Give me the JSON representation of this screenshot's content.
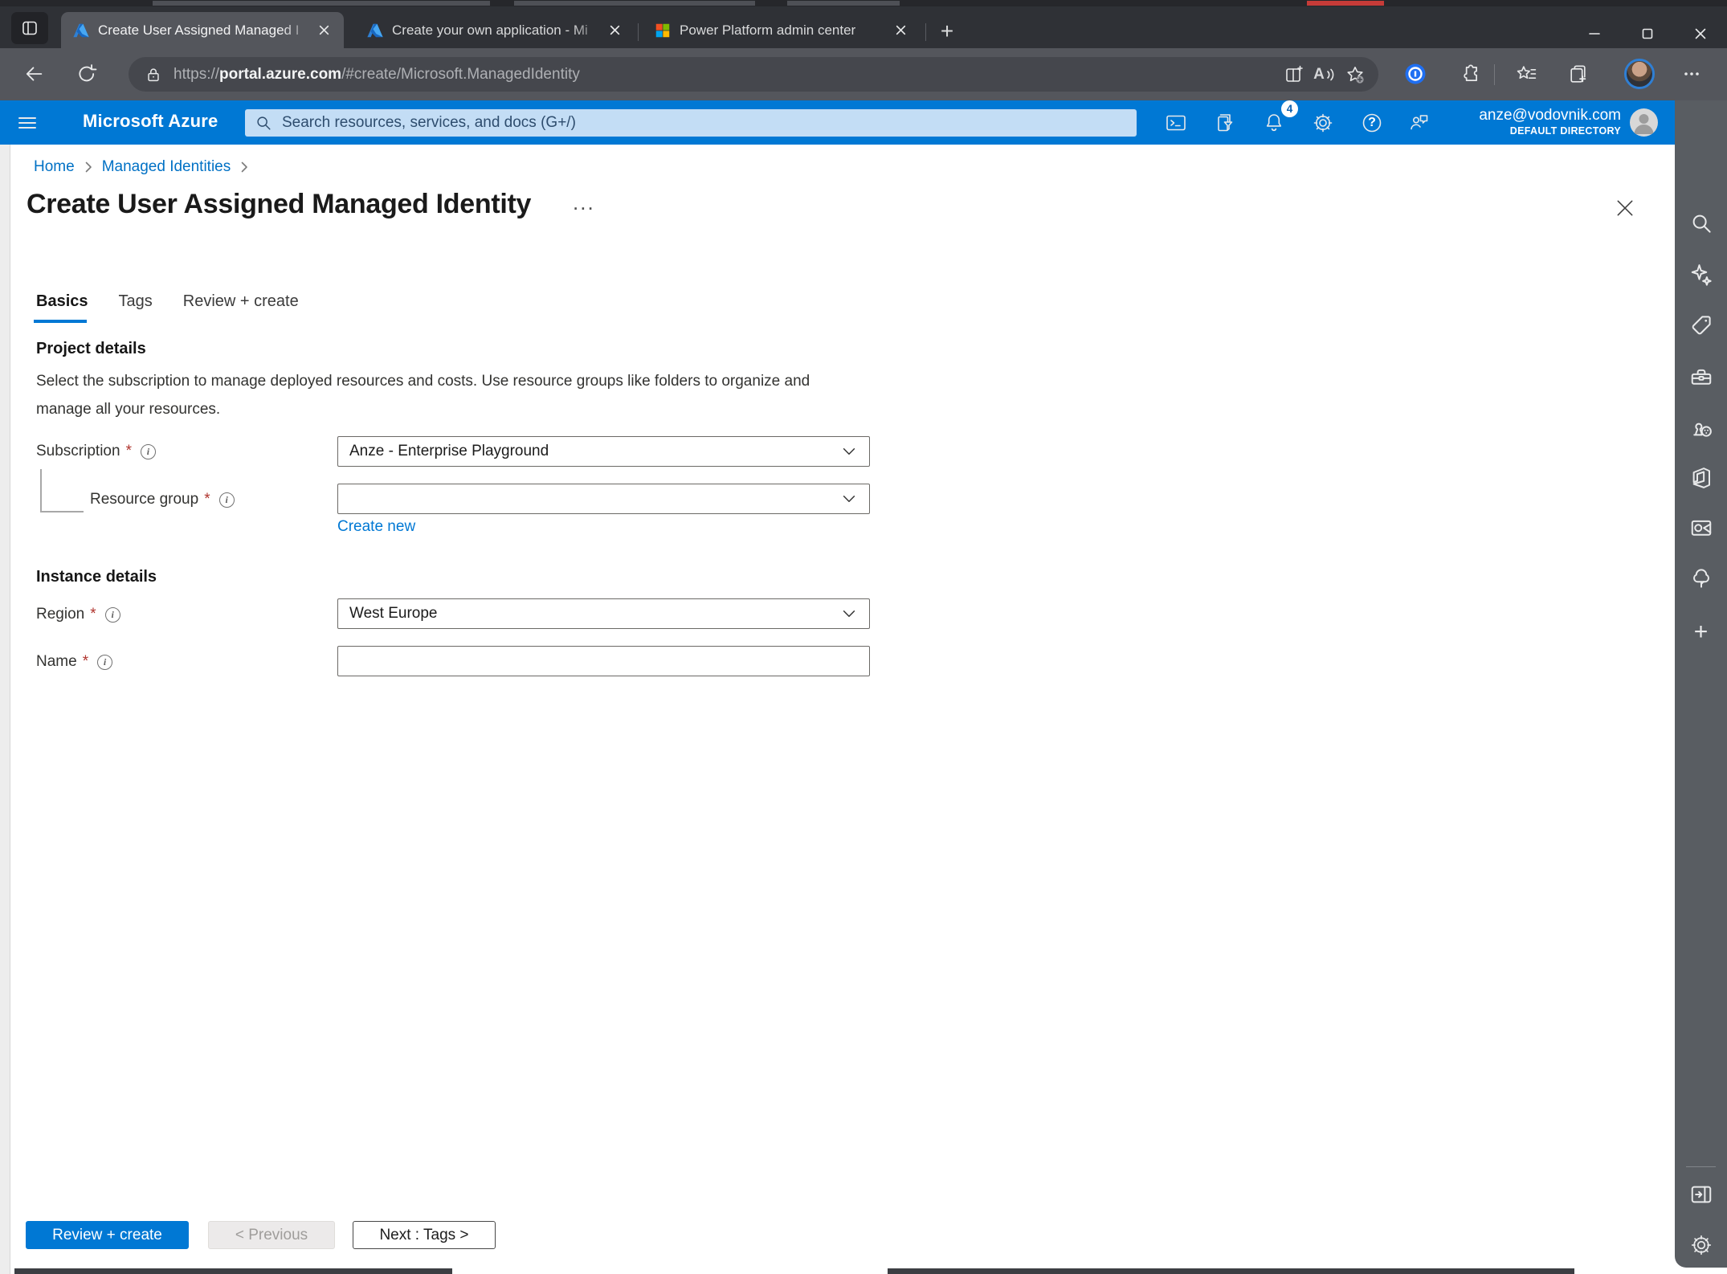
{
  "browser": {
    "tabs": [
      {
        "title": "Create User Assigned Managed I"
      },
      {
        "title": "Create your own application - Mi"
      },
      {
        "title": "Power Platform admin center"
      }
    ],
    "url": {
      "prefix": "https://",
      "domain": "portal.azure.com",
      "rest": "/#create/Microsoft.ManagedIdentity"
    }
  },
  "azure_bar": {
    "brand": "Microsoft Azure",
    "search_placeholder": "Search resources, services, and docs (G+/)",
    "notification_count": "4",
    "account": {
      "email": "anze@vodovnik.com",
      "directory": "DEFAULT DIRECTORY"
    }
  },
  "page": {
    "breadcrumb": {
      "home": "Home",
      "managed_identities": "Managed Identities"
    },
    "title": "Create User Assigned Managed Identity",
    "tabs": {
      "basics": "Basics",
      "tags": "Tags",
      "review": "Review + create"
    },
    "form": {
      "required_marker": "*",
      "project_details": {
        "heading": "Project details",
        "description": "Select the subscription to manage deployed resources and costs. Use resource groups like folders to organize and manage all your resources."
      },
      "subscription": {
        "label": "Subscription",
        "value": "Anze - Enterprise Playground"
      },
      "resource_group": {
        "label": "Resource group",
        "value": "",
        "create_new": "Create new"
      },
      "instance_details": {
        "heading": "Instance details"
      },
      "region": {
        "label": "Region",
        "value": "West Europe"
      },
      "name": {
        "label": "Name",
        "value": ""
      }
    },
    "footer": {
      "review_create": "Review + create",
      "previous": "< Previous",
      "next": "Next : Tags >"
    }
  },
  "icons": {
    "plus_glyph": "+",
    "help_glyph": "?",
    "info_glyph": "i",
    "more_glyph": "...",
    "read_aloud_glyph": "A"
  },
  "colors": {
    "azure_blue": "#0078d4",
    "link_blue": "#0071c5",
    "primary_button": "#0078d4",
    "tab_underline": "#0078d4",
    "required_red": "#b0342e",
    "search_box": "#c3ddf5",
    "sidebar_gray": "#595d62",
    "toolbar_gray": "#54565c",
    "tabstrip_gray": "#2f3136"
  }
}
